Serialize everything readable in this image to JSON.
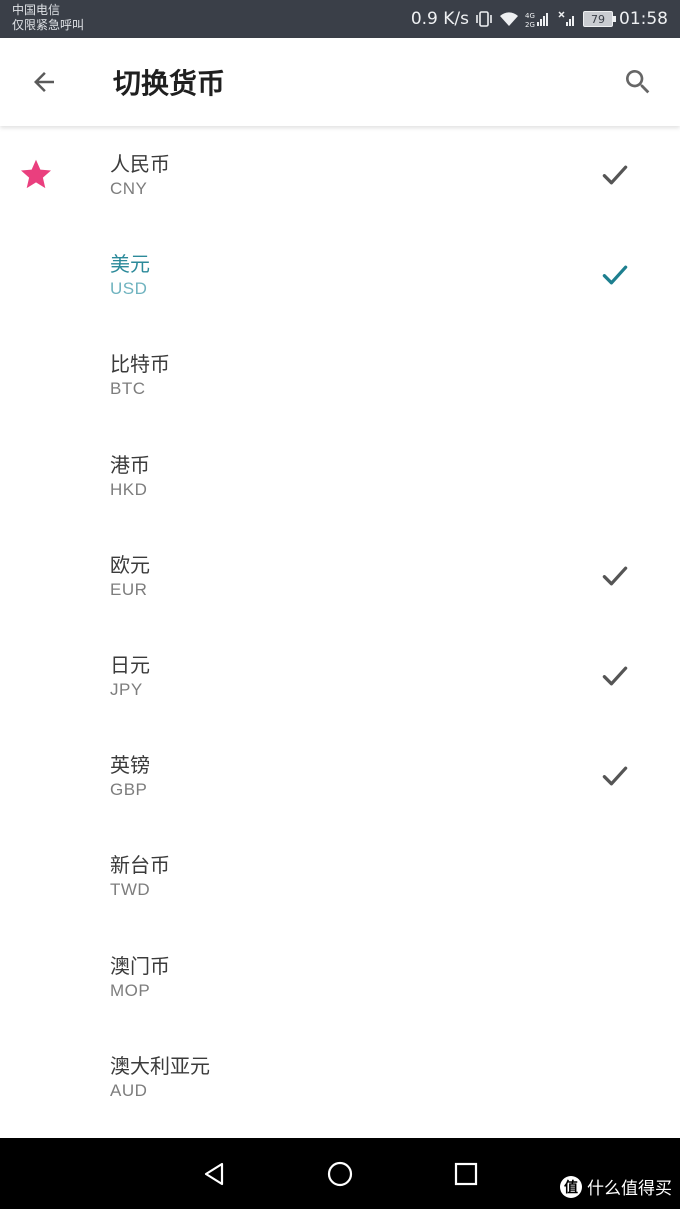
{
  "status_bar": {
    "carrier_line1": "中国电信",
    "carrier_line2": "仅限紧急呼叫",
    "net_speed": "0.9 K/s",
    "net_type": "4G 2G",
    "battery": "79",
    "time": "01:58"
  },
  "toolbar": {
    "title": "切换货币",
    "back_icon": "arrow-back-icon",
    "search_icon": "search-icon"
  },
  "colors": {
    "star": "#ea3f7e",
    "active_text": "#2c8a9a",
    "check": "#555555",
    "active_check": "#1d7f8f"
  },
  "currencies": [
    {
      "name": "人民币",
      "code": "CNY",
      "starred": true,
      "checked": true,
      "active": false
    },
    {
      "name": "美元",
      "code": "USD",
      "starred": false,
      "checked": true,
      "active": true
    },
    {
      "name": "比特币",
      "code": "BTC",
      "starred": false,
      "checked": false,
      "active": false
    },
    {
      "name": "港币",
      "code": "HKD",
      "starred": false,
      "checked": false,
      "active": false
    },
    {
      "name": "欧元",
      "code": "EUR",
      "starred": false,
      "checked": true,
      "active": false
    },
    {
      "name": "日元",
      "code": "JPY",
      "starred": false,
      "checked": true,
      "active": false
    },
    {
      "name": "英镑",
      "code": "GBP",
      "starred": false,
      "checked": true,
      "active": false
    },
    {
      "name": "新台币",
      "code": "TWD",
      "starred": false,
      "checked": false,
      "active": false
    },
    {
      "name": "澳门币",
      "code": "MOP",
      "starred": false,
      "checked": false,
      "active": false
    },
    {
      "name": "澳大利亚元",
      "code": "AUD",
      "starred": false,
      "checked": false,
      "active": false
    }
  ],
  "nav_bar": {
    "back_icon": "nav-back-icon",
    "home_icon": "nav-home-icon",
    "recents_icon": "nav-recents-icon"
  },
  "watermark": {
    "badge": "值",
    "text": "什么值得买"
  }
}
